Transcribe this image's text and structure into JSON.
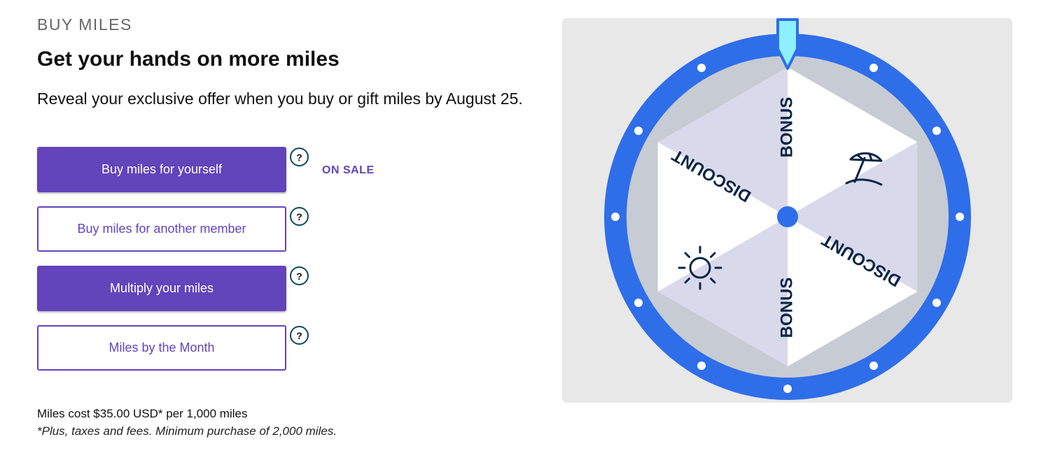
{
  "header": {
    "eyebrow": "BUY MILES",
    "title": "Get your hands on more miles",
    "subtitle": "Reveal your exclusive offer when you buy or gift miles by August 25."
  },
  "actions": [
    {
      "label": "Buy miles for yourself",
      "style": "filled",
      "help": "?"
    },
    {
      "label": "Buy miles for another member",
      "style": "outline",
      "help": "?"
    },
    {
      "label": "Multiply your miles",
      "style": "filled",
      "help": "?"
    },
    {
      "label": "Miles by the Month",
      "style": "outline",
      "help": "?"
    }
  ],
  "sale_badge": "ON SALE",
  "pricing": {
    "cost": "Miles cost $35.00 USD* per 1,000 miles",
    "note": "*Plus, taxes and fees. Minimum purchase of 2,000 miles."
  },
  "wheel": {
    "segments": [
      {
        "label": "BONUS",
        "icon": null
      },
      {
        "label": null,
        "icon": "beach-umbrella-icon"
      },
      {
        "label": "DISCOUNT",
        "icon": null
      },
      {
        "label": "BONUS",
        "icon": null
      },
      {
        "label": null,
        "icon": "sun-icon"
      },
      {
        "label": "DISCOUNT",
        "icon": null
      }
    ]
  },
  "colors": {
    "brand_purple": "#6244bb",
    "wheel_rim": "#2f6ee9",
    "wheel_ring": "#c7cbd4",
    "segment_light": "#ffffff",
    "segment_shaded": "#d8d9ea",
    "label": "#0b2545",
    "pointer": "#8ef0ff",
    "help_border": "#0c4a5a"
  }
}
